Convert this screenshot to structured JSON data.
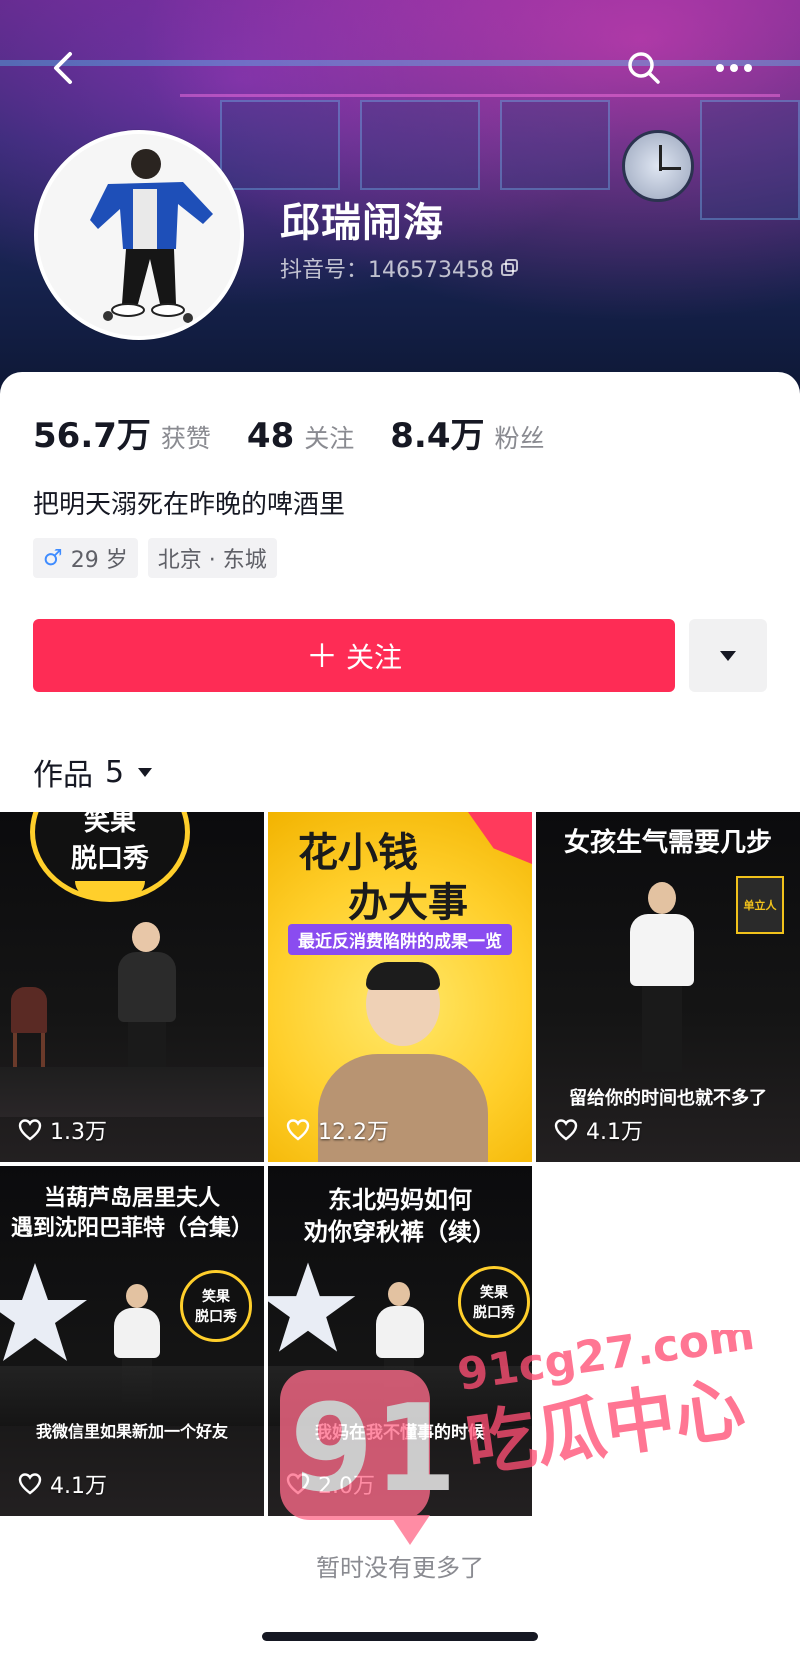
{
  "header": {
    "back_icon": "chevron-left-icon",
    "search_icon": "search-icon",
    "more_icon": "more-horizontal-icon"
  },
  "profile": {
    "nickname": "邱瑞闹海",
    "uid_text": "抖音号：146573458",
    "copy_icon": "copy-icon"
  },
  "stats": [
    {
      "value": "56.7万",
      "label": "获赞"
    },
    {
      "value": "48",
      "label": "关注"
    },
    {
      "value": "8.4万",
      "label": "粉丝"
    }
  ],
  "bio": "把明天溺死在昨晚的啤酒里",
  "tags": {
    "gender_age": "29 岁",
    "location": "北京 · 东城"
  },
  "actions": {
    "follow_label": "关注",
    "follow_plus": "＋",
    "more_icon": "caret-down-icon"
  },
  "works_tab": {
    "label": "作品",
    "count": "5"
  },
  "videos": [
    {
      "likes": "1.3万",
      "logo_line1": "笑果",
      "logo_line2": "脱口秀"
    },
    {
      "likes": "12.2万",
      "title_line1": "花小钱",
      "title_line2": "办大事",
      "subtitle": "最近反消费陷阱的成果一览"
    },
    {
      "likes": "4.1万",
      "title": "女孩生气需要几步",
      "subtitle": "留给你的时间也就不多了",
      "badge": "单立人"
    },
    {
      "likes": "4.1万",
      "title_line1": "当葫芦岛居里夫人",
      "title_line2": "遇到沈阳巴菲特（合集）",
      "subtitle": "我微信里如果新加一个好友",
      "logo_line1": "笑果",
      "logo_line2": "脱口秀"
    },
    {
      "likes": "2.0万",
      "title_line1": "东北妈妈如何",
      "title_line2": "劝你穿秋裤（续）",
      "subtitle": "我妈在我不懂事的时候",
      "logo_line1": "笑果",
      "logo_line2": "脱口秀"
    }
  ],
  "footer": "暂时没有更多了",
  "watermark": {
    "number": "91",
    "site": "91cg27.com",
    "name": "吃瓜中心"
  },
  "colors": {
    "accent": "#fe2c55",
    "text": "#161823",
    "muted": "#8a8b91"
  }
}
